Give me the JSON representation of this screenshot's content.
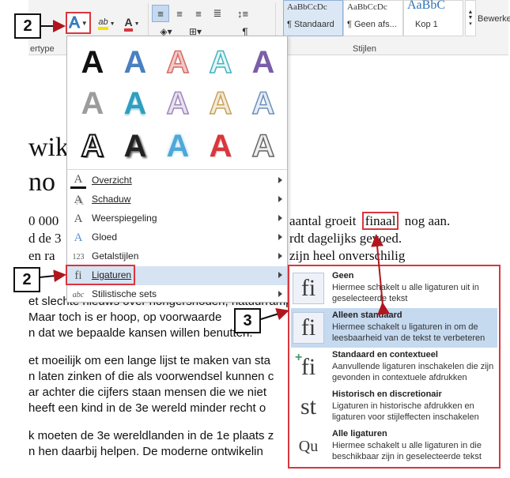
{
  "ribbon": {
    "font_group_label": "ertype",
    "styles_group_label": "Stijlen",
    "edit_label": "Bewerke",
    "styles": [
      {
        "preview": "AaBbCcDc",
        "name": "¶ Standaard"
      },
      {
        "preview": "AaBbCcDc",
        "name": "¶ Geen afs..."
      },
      {
        "preview": "AaBbC",
        "name": "Kop 1"
      }
    ],
    "paragraph_mark": "¶",
    "highlight_text": "ab",
    "font_color_text": "A"
  },
  "document": {
    "heading_line1": "wik                    king :",
    "heading_line2": "no",
    "lines": [
      {
        "text": "0 000",
        "right": "aantal groeit",
        "boxed": "finaal",
        "tail": "nog aan."
      },
      {
        "text": "d de 3",
        "right": "rdt dagelijks gevoed."
      },
      {
        "text": "en ra",
        "right": "zijn heel onverschilig"
      },
      {
        "text": "et slechte nieuws over hongersnoden, natuurrampen"
      },
      {
        "text": "Maar toch is er hoop, op voorwaarde"
      },
      {
        "text": "n dat we bepaalde kansen willen benutten."
      },
      {
        "text": "et moeilijk om een lange lijst te maken van sta"
      },
      {
        "text": "n laten zinken of die als voorwendsel kunnen c"
      },
      {
        "text": "ar achter die cijfers staan mensen die we niet"
      },
      {
        "text": "heeft een kind in de 3e wereld minder recht o"
      },
      {
        "text": "k moeten de 3e wereldlanden in de 1e plaats z"
      },
      {
        "text": "n hen daarbij helpen. De moderne ontwikelin"
      }
    ]
  },
  "effects_menu": {
    "items": [
      {
        "label": "Overzicht",
        "icon": "outline-icon",
        "glyph": "A"
      },
      {
        "label": "Schaduw",
        "icon": "shadow-icon",
        "glyph": "A"
      },
      {
        "label": "Weerspiegeling",
        "icon": "reflection-icon",
        "glyph": "A"
      },
      {
        "label": "Gloed",
        "icon": "glow-icon",
        "glyph": "A"
      },
      {
        "label": "Getalstijlen",
        "icon": "number-styles-icon",
        "glyph": "123"
      },
      {
        "label": "Ligaturen",
        "icon": "ligature-icon",
        "glyph": "fi"
      },
      {
        "label": "Stilistische sets",
        "icon": "stylistic-sets-icon",
        "glyph": "abc"
      }
    ],
    "effect_letter": "A"
  },
  "ligatures_submenu": {
    "items": [
      {
        "title": "Geen",
        "desc": "Hiermee schakelt u alle ligaturen uit in geselecteerde tekst",
        "glyph": "fi"
      },
      {
        "title": "Alleen standaard",
        "desc": "Hiermee schakelt u ligaturen in om de leesbaarheid van de tekst te verbeteren",
        "glyph": "fi"
      },
      {
        "title": "Standaard en contextueel",
        "desc": "Aanvullende ligaturen inschakelen die zijn gevonden in contextuele afdrukken",
        "glyph": "fi"
      },
      {
        "title": "Historisch en discretionair",
        "desc": "Ligaturen in historische afdrukken en ligaturen voor stijleffecten inschakelen",
        "glyph": "st"
      },
      {
        "title": "Alle ligaturen",
        "desc": "Hiermee schakelt u alle ligaturen in die beschikbaar zijn in geselecteerde tekst",
        "glyph": "Qu"
      }
    ]
  },
  "callouts": {
    "step2a": "2",
    "step2b": "2",
    "step3": "3"
  },
  "colors": {
    "accent_red": "#d9363e",
    "highlight_blue": "#d5e3f3",
    "selection_blue": "#c5d9ef"
  }
}
